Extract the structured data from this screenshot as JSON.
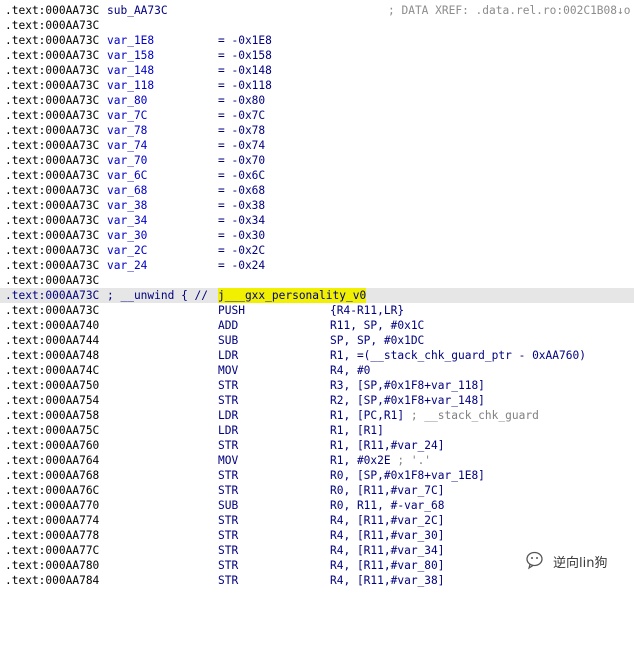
{
  "header": {
    "addr": ".text:000AA73C",
    "name": "sub_AA73C",
    "xref": "; DATA XREF: .data.rel.ro:002C1B08↓o"
  },
  "vars": [
    {
      "addr": ".text:000AA73C",
      "name": "var_1E8",
      "eq": "= -0x1E8"
    },
    {
      "addr": ".text:000AA73C",
      "name": "var_158",
      "eq": "= -0x158"
    },
    {
      "addr": ".text:000AA73C",
      "name": "var_148",
      "eq": "= -0x148"
    },
    {
      "addr": ".text:000AA73C",
      "name": "var_118",
      "eq": "= -0x118"
    },
    {
      "addr": ".text:000AA73C",
      "name": "var_80",
      "eq": "= -0x80"
    },
    {
      "addr": ".text:000AA73C",
      "name": "var_7C",
      "eq": "= -0x7C"
    },
    {
      "addr": ".text:000AA73C",
      "name": "var_78",
      "eq": "= -0x78"
    },
    {
      "addr": ".text:000AA73C",
      "name": "var_74",
      "eq": "= -0x74"
    },
    {
      "addr": ".text:000AA73C",
      "name": "var_70",
      "eq": "= -0x70"
    },
    {
      "addr": ".text:000AA73C",
      "name": "var_6C",
      "eq": "= -0x6C"
    },
    {
      "addr": ".text:000AA73C",
      "name": "var_68",
      "eq": "= -0x68"
    },
    {
      "addr": ".text:000AA73C",
      "name": "var_38",
      "eq": "= -0x38"
    },
    {
      "addr": ".text:000AA73C",
      "name": "var_34",
      "eq": "= -0x34"
    },
    {
      "addr": ".text:000AA73C",
      "name": "var_30",
      "eq": "= -0x30"
    },
    {
      "addr": ".text:000AA73C",
      "name": "var_2C",
      "eq": "= -0x2C"
    },
    {
      "addr": ".text:000AA73C",
      "name": "var_24",
      "eq": "= -0x24"
    }
  ],
  "blank_before_unwind": {
    "addr": ".text:000AA73C"
  },
  "unwind": {
    "addr": ".text:000AA73C",
    "prefix": "; __unwind { // ",
    "target": "j___gxx_personality_v0"
  },
  "instructions": [
    {
      "addr": ".text:000AA73C",
      "mnem": "PUSH",
      "ops": "{R4-R11,LR}",
      "comment": ""
    },
    {
      "addr": ".text:000AA740",
      "mnem": "ADD",
      "ops": "R11, SP, #0x1C",
      "comment": ""
    },
    {
      "addr": ".text:000AA744",
      "mnem": "SUB",
      "ops": "SP, SP, #0x1DC",
      "comment": ""
    },
    {
      "addr": ".text:000AA748",
      "mnem": "LDR",
      "ops": "R1, =(__stack_chk_guard_ptr - 0xAA760)",
      "comment": ""
    },
    {
      "addr": ".text:000AA74C",
      "mnem": "MOV",
      "ops": "R4, #0",
      "comment": ""
    },
    {
      "addr": ".text:000AA750",
      "mnem": "STR",
      "ops": "R3, [SP,#0x1F8+var_118]",
      "comment": ""
    },
    {
      "addr": ".text:000AA754",
      "mnem": "STR",
      "ops": "R2, [SP,#0x1F8+var_148]",
      "comment": ""
    },
    {
      "addr": ".text:000AA758",
      "mnem": "LDR",
      "ops": "R1, [PC,R1]",
      "comment": " ; __stack_chk_guard"
    },
    {
      "addr": ".text:000AA75C",
      "mnem": "LDR",
      "ops": "R1, [R1]",
      "comment": ""
    },
    {
      "addr": ".text:000AA760",
      "mnem": "STR",
      "ops": "R1, [R11,#var_24]",
      "comment": ""
    },
    {
      "addr": ".text:000AA764",
      "mnem": "MOV",
      "ops": "R1, #0x2E",
      "comment": " ; '.'"
    },
    {
      "addr": ".text:000AA768",
      "mnem": "STR",
      "ops": "R0, [SP,#0x1F8+var_1E8]",
      "comment": ""
    },
    {
      "addr": ".text:000AA76C",
      "mnem": "STR",
      "ops": "R0, [R11,#var_7C]",
      "comment": ""
    },
    {
      "addr": ".text:000AA770",
      "mnem": "SUB",
      "ops": "R0, R11, #-var_68",
      "comment": ""
    },
    {
      "addr": ".text:000AA774",
      "mnem": "STR",
      "ops": "R4, [R11,#var_2C]",
      "comment": ""
    },
    {
      "addr": ".text:000AA778",
      "mnem": "STR",
      "ops": "R4, [R11,#var_30]",
      "comment": ""
    },
    {
      "addr": ".text:000AA77C",
      "mnem": "STR",
      "ops": "R4, [R11,#var_34]",
      "comment": ""
    },
    {
      "addr": ".text:000AA780",
      "mnem": "STR",
      "ops": "R4, [R11,#var_80]",
      "comment": ""
    },
    {
      "addr": ".text:000AA784",
      "mnem": "STR",
      "ops": "R4, [R11,#var_38]",
      "comment": ""
    }
  ],
  "watermark": {
    "icon": "wechat-icon",
    "text": "逆向lin狗"
  }
}
